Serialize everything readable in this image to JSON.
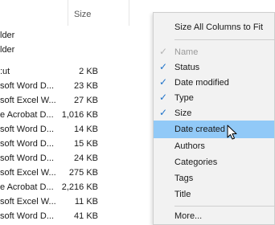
{
  "header": {
    "size_label": "Size"
  },
  "files": [
    {
      "type": "lder",
      "size": ""
    },
    {
      "type": "lder",
      "size": ""
    },
    {
      "type": ":ut",
      "size": "2 KB"
    },
    {
      "type": "soft Word D...",
      "size": "23 KB"
    },
    {
      "type": "soft Excel W...",
      "size": "27 KB"
    },
    {
      "type": "e Acrobat D...",
      "size": "1,016 KB"
    },
    {
      "type": "soft Word D...",
      "size": "14 KB"
    },
    {
      "type": "soft Word D...",
      "size": "15 KB"
    },
    {
      "type": "soft Word D...",
      "size": "24 KB"
    },
    {
      "type": "soft Excel W...",
      "size": "275 KB"
    },
    {
      "type": "e Acrobat D...",
      "size": "2,216 KB"
    },
    {
      "type": "soft Excel W...",
      "size": "11 KB"
    },
    {
      "type": "soft Word D...",
      "size": "41 KB"
    }
  ],
  "menu": {
    "fit_label": "Size All Columns to Fit",
    "items": [
      {
        "label": "Name",
        "checked": true,
        "disabled": true
      },
      {
        "label": "Status",
        "checked": true,
        "disabled": false
      },
      {
        "label": "Date modified",
        "checked": true,
        "disabled": false
      },
      {
        "label": "Type",
        "checked": true,
        "disabled": false
      },
      {
        "label": "Size",
        "checked": true,
        "disabled": false
      },
      {
        "label": "Date created",
        "checked": false,
        "disabled": false,
        "highlighted": true
      },
      {
        "label": "Authors",
        "checked": false,
        "disabled": false
      },
      {
        "label": "Categories",
        "checked": false,
        "disabled": false
      },
      {
        "label": "Tags",
        "checked": false,
        "disabled": false
      },
      {
        "label": "Title",
        "checked": false,
        "disabled": false
      }
    ],
    "more_label": "More..."
  },
  "colors": {
    "highlight": "#91c9f7",
    "checkmark": "#1e72c9"
  },
  "icons": {
    "check": "checkmark-icon",
    "cursor": "mouse-pointer-icon"
  }
}
